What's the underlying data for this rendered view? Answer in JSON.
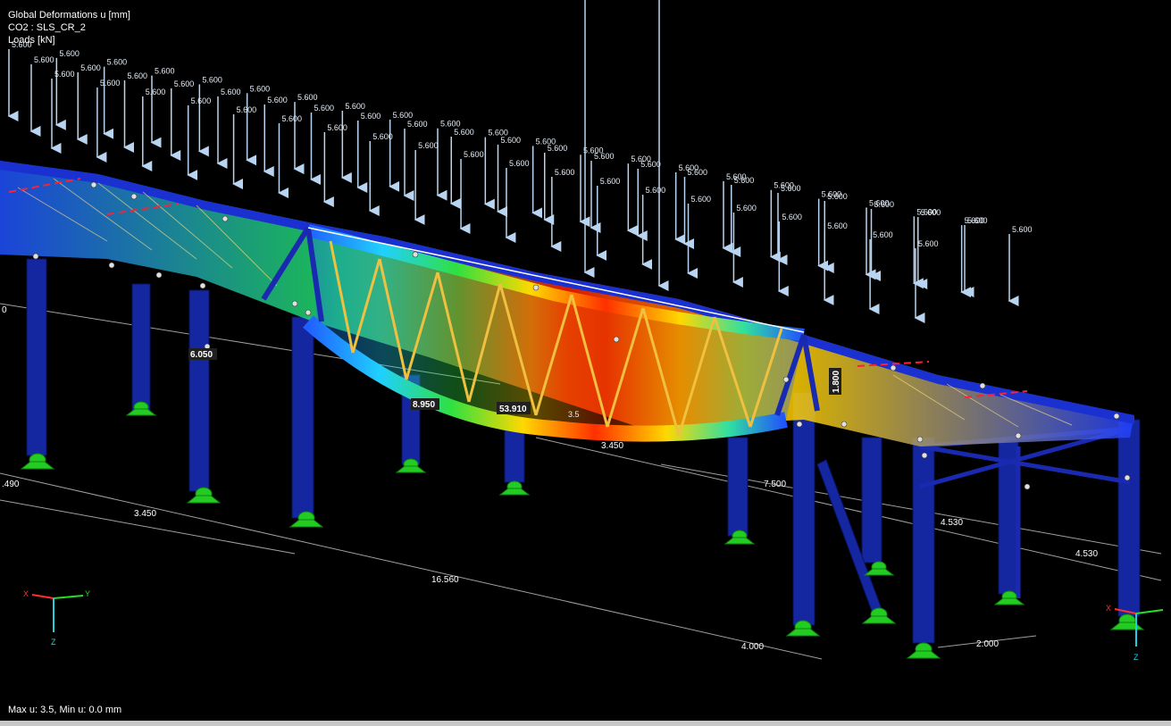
{
  "hud": {
    "title": "Global Deformations u [mm]",
    "combination": "CO2 : SLS_CR_2",
    "loads": "Loads [kN]"
  },
  "status": "Max u: 3.5, Min u: 0.0 mm",
  "load_label": "5.600",
  "result_labels": {
    "max_deformation": "53.910",
    "max_u": "3.5",
    "length_a": "8.950",
    "length_b": "6.050",
    "height": "1.800"
  },
  "dimensions": {
    "d1": "3.450",
    "d2": "16.560",
    "d3": "4.000",
    "d4": "2.000",
    "d5": "3.450",
    "d6": "7.500",
    "d7": "4.530",
    "d8": "4.530",
    "d9": ".490",
    "d10": "0"
  },
  "axes": {
    "x": "X",
    "y": "Y",
    "z": "Z"
  },
  "colors": {
    "background": "#000000",
    "member": "#1a2aa8",
    "load_arrow": "#b8d4f0",
    "support": "#22cc22",
    "dimension": "#bbbbbb",
    "deform_max": "#ff2000",
    "deform_mid": "#ffd800",
    "deform_low": "#20c8ff"
  }
}
